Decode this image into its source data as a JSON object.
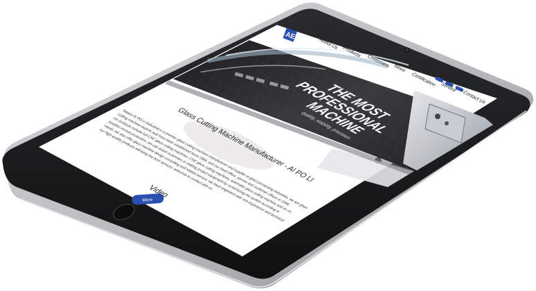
{
  "brand": {
    "logo_text": "AE",
    "colors": {
      "accent": "#2a4fb0",
      "text_dark": "#222222",
      "bezel": "#1a1a1b",
      "body": "#bfc1c4"
    }
  },
  "nav": {
    "items": [
      {
        "label": "About Us"
      },
      {
        "label": "Products"
      },
      {
        "label": "Customers"
      },
      {
        "label": "News"
      },
      {
        "label": "Certification"
      },
      {
        "label": "Service"
      },
      {
        "label": "Contact Us"
      }
    ]
  },
  "hero": {
    "headline_1": "THE MOST",
    "headline_2": "PROFESSIONAL",
    "headline_3": "MACHINE",
    "tagline": "quality, stability, precision"
  },
  "intro": {
    "title": "Glass Cutting Machine Manufacturer - AI PO LI",
    "paragraph_lines": [
      "Taiwan AI PO LI Industrial is a premier glass cutting machine manufacturer and supplier in glass processing industries, we are glass",
      "cutting machine experts and have been established since 1984, and our head office, service and customer offices in 1998,",
      "our products include full CNC glass cutting machines, CNC glass cutting machines, automatic glass cutting machine and so on,",
      "besides normal production, we can assist customers in making project equipment by customizing the system according to",
      "needs, we also offer glass machine design consulting and related service, we have engineers with rich experience and technical",
      "our high-quality products will bring the best services, welcome to contact with us."
    ],
    "more_button": "More"
  },
  "video": {
    "title": "Video"
  }
}
